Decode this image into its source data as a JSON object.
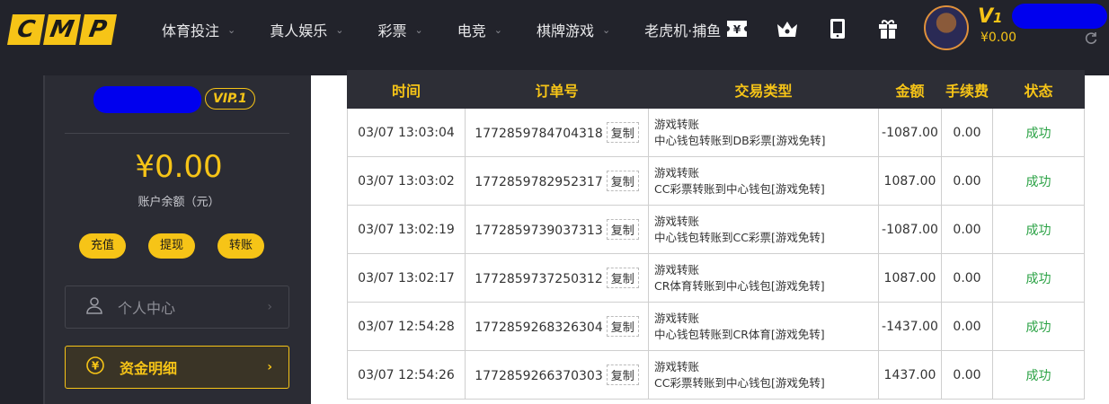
{
  "logo": {
    "letters": [
      "C",
      "M",
      "P"
    ]
  },
  "nav": [
    {
      "label": "体育投注"
    },
    {
      "label": "真人娱乐"
    },
    {
      "label": "彩票"
    },
    {
      "label": "电竞"
    },
    {
      "label": "棋牌游戏"
    },
    {
      "label": "老虎机·捕鱼"
    }
  ],
  "header_user": {
    "level": "V",
    "level_num": "1",
    "balance": "¥0.00"
  },
  "sidebar": {
    "vip_badge": "VIP.1",
    "balance": "¥0.00",
    "balance_label": "账户余额（元）",
    "buttons": {
      "deposit": "充值",
      "withdraw": "提现",
      "transfer": "转账"
    },
    "menu_personal": "个人中心",
    "menu_funds": "资金明细"
  },
  "table": {
    "headers": {
      "time": "时间",
      "order": "订单号",
      "type": "交易类型",
      "amount": "金额",
      "fee": "手续费",
      "status": "状态"
    },
    "copy_label": "复制",
    "rows": [
      {
        "time": "03/07 13:03:04",
        "order": "1772859784704318",
        "type": "游戏转账",
        "detail": "中心钱包转账到DB彩票[游戏免转]",
        "amount": "-1087.00",
        "fee": "0.00",
        "status": "成功"
      },
      {
        "time": "03/07 13:03:02",
        "order": "1772859782952317",
        "type": "游戏转账",
        "detail": "CC彩票转账到中心钱包[游戏免转]",
        "amount": "1087.00",
        "fee": "0.00",
        "status": "成功"
      },
      {
        "time": "03/07 13:02:19",
        "order": "1772859739037313",
        "type": "游戏转账",
        "detail": "中心钱包转账到CC彩票[游戏免转]",
        "amount": "-1087.00",
        "fee": "0.00",
        "status": "成功"
      },
      {
        "time": "03/07 13:02:17",
        "order": "1772859737250312",
        "type": "游戏转账",
        "detail": "CR体育转账到中心钱包[游戏免转]",
        "amount": "1087.00",
        "fee": "0.00",
        "status": "成功"
      },
      {
        "time": "03/07 12:54:28",
        "order": "1772859268326304",
        "type": "游戏转账",
        "detail": "中心钱包转账到CR体育[游戏免转]",
        "amount": "-1437.00",
        "fee": "0.00",
        "status": "成功"
      },
      {
        "time": "03/07 12:54:26",
        "order": "1772859266370303",
        "type": "游戏转账",
        "detail": "CC彩票转账到中心钱包[游戏免转]",
        "amount": "1437.00",
        "fee": "0.00",
        "status": "成功"
      }
    ]
  },
  "colors": {
    "accent": "#f6c417",
    "dark": "#22232b",
    "success": "#2ba245"
  },
  "icons": [
    "ticket-icon",
    "crown-icon",
    "tablet-icon",
    "gift-icon",
    "refresh-icon",
    "user-icon",
    "yen-coin-icon"
  ]
}
